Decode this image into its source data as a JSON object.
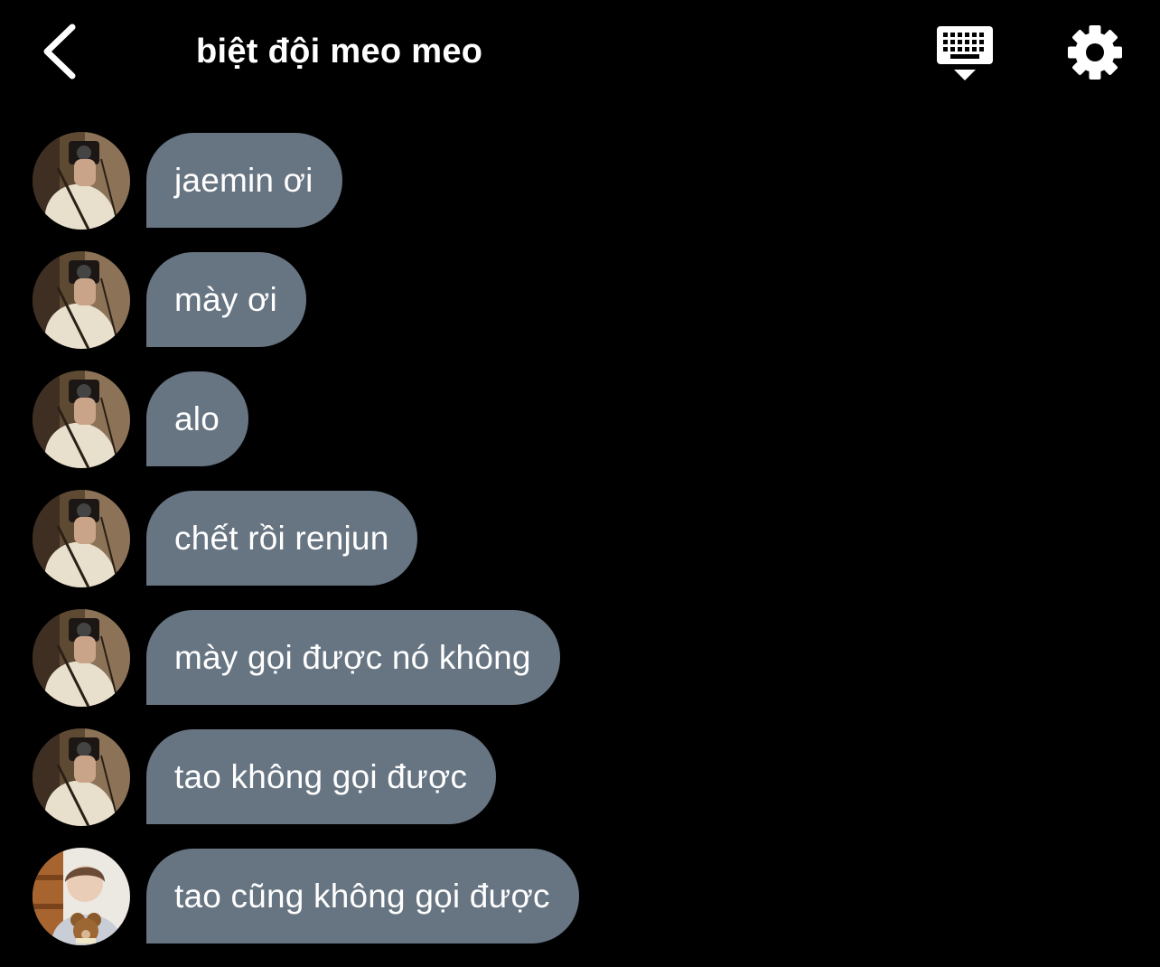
{
  "header": {
    "title": "biệt đội meo meo",
    "icons": {
      "back": "chevron-left-icon",
      "keyboard": "keyboard-hide-icon",
      "settings": "gear-icon"
    }
  },
  "colors": {
    "background": "#000000",
    "bubble": "#677482",
    "text": "#ffffff"
  },
  "messages": [
    {
      "text": "jaemin ơi",
      "avatar": "avatar-mirror-selfie"
    },
    {
      "text": "mày ơi",
      "avatar": "avatar-mirror-selfie"
    },
    {
      "text": "alo",
      "avatar": "avatar-mirror-selfie"
    },
    {
      "text": "chết rồi renjun",
      "avatar": "avatar-mirror-selfie"
    },
    {
      "text": "mày gọi được nó không",
      "avatar": "avatar-mirror-selfie"
    },
    {
      "text": "tao không gọi được",
      "avatar": "avatar-mirror-selfie"
    },
    {
      "text": "tao cũng không gọi được",
      "avatar": "avatar-teddy-bear"
    }
  ]
}
